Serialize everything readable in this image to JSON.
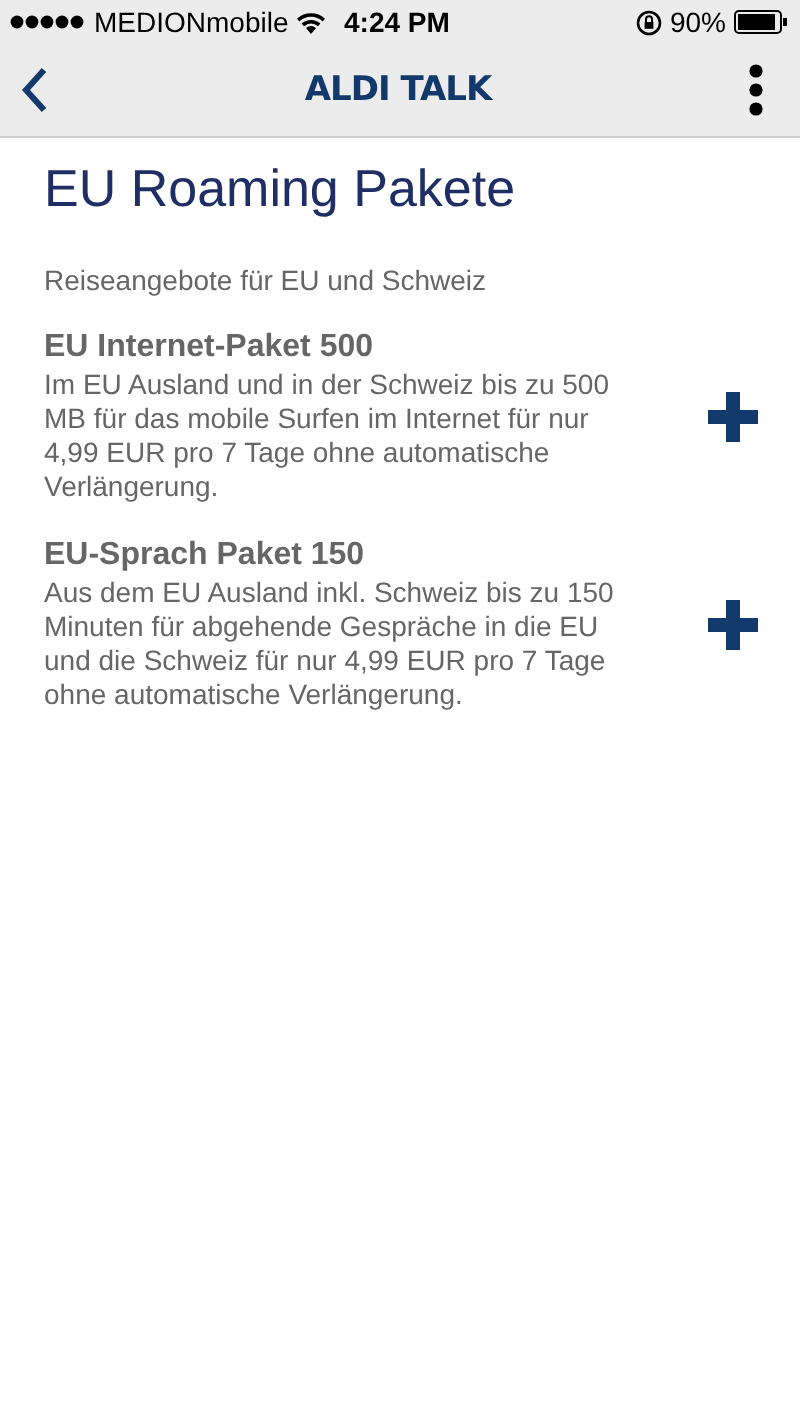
{
  "status_bar": {
    "carrier": "MEDIONmobile",
    "time": "4:24 PM",
    "battery": "90%"
  },
  "nav_bar": {
    "title": "ALDI TALK"
  },
  "page": {
    "title": "EU Roaming Pakete",
    "subtitle": "Reiseangebote für EU und Schweiz"
  },
  "packages": [
    {
      "name": "EU Internet-Paket 500",
      "description": "Im EU Ausland und in der Schweiz bis zu 500 MB für das mobile Surfen im Internet für nur 4,99 EUR pro 7 Tage ohne automatische Verlängerung."
    },
    {
      "name": "EU-Sprach Paket 150",
      "description": "Aus dem EU Ausland inkl. Schweiz bis zu 150 Minuten für abgehende Gespräche in die EU und die Schweiz für nur 4,99 EUR pro 7 Tage ohne automatische Verlängerung."
    }
  ]
}
